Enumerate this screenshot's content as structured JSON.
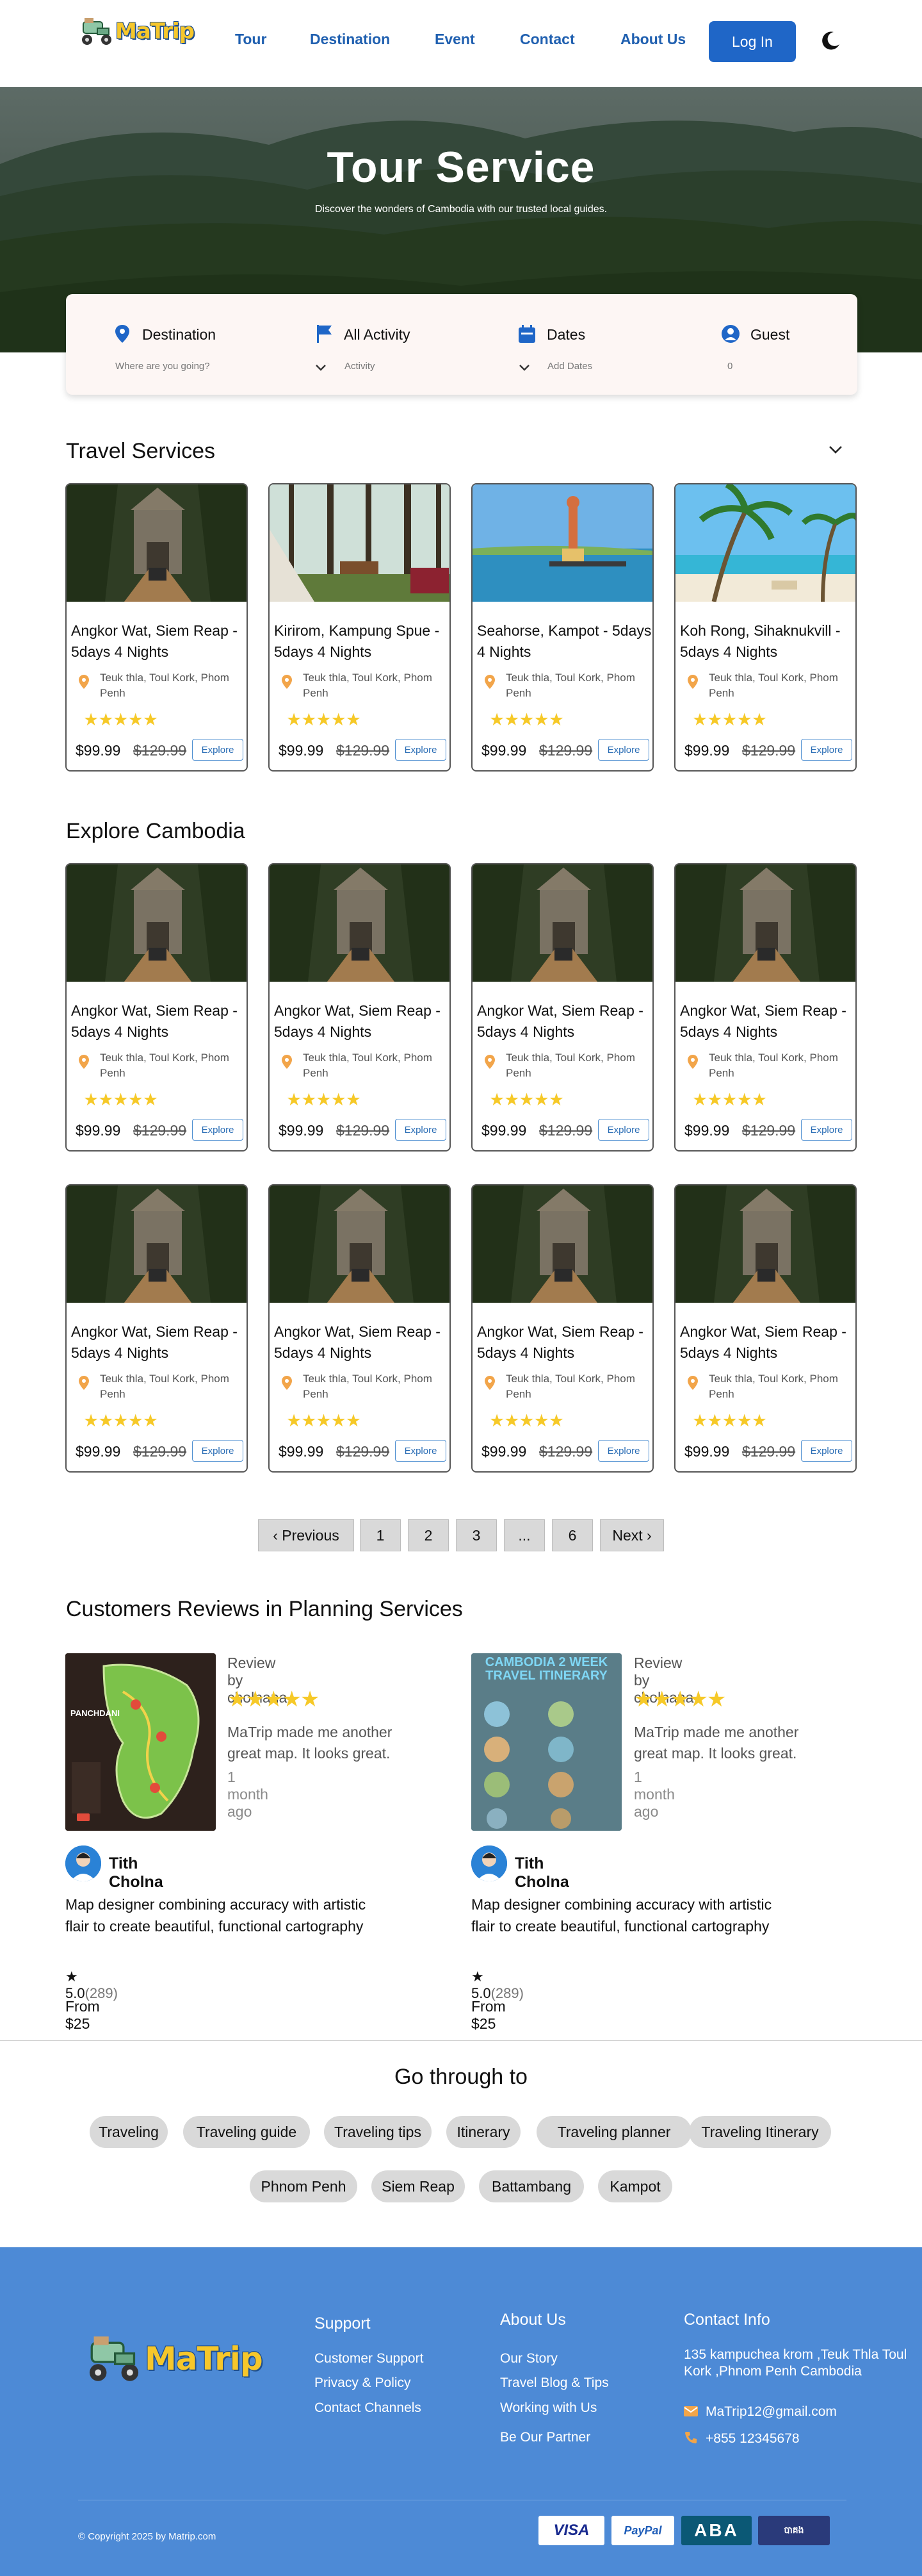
{
  "brand": {
    "logo_text": "MaTrip"
  },
  "nav": {
    "links": [
      "Tour",
      "Destination",
      "Event",
      "Contact",
      "About Us"
    ],
    "login": "Log In"
  },
  "hero": {
    "title": "Tour Service",
    "subtitle": "Discover the wonders of Cambodia with our trusted local guides."
  },
  "search": {
    "destination": {
      "label": "Destination",
      "placeholder": "Where are you going?"
    },
    "activity": {
      "label": "All Activity",
      "placeholder": "Activity"
    },
    "dates": {
      "label": "Dates",
      "placeholder": "Add Dates"
    },
    "guest": {
      "label": "Guest",
      "value": "0"
    }
  },
  "travel_services": {
    "title": "Travel Services",
    "cards": [
      {
        "title": "Angkor Wat, Siem Reap - 5days  4 Nights",
        "location": "Teuk thla, Toul Kork, Phom Penh",
        "stars": "★★★★★",
        "price": "$99.99",
        "old_price": "$129.99",
        "cta": "Explore"
      },
      {
        "title": "Kirirom, Kampung Spue - 5days  4 Nights",
        "location": "Teuk thla, Toul Kork, Phom Penh",
        "stars": "★★★★★",
        "price": "$99.99",
        "old_price": "$129.99",
        "cta": "Explore"
      },
      {
        "title": "Seahorse, Kampot  - 5days  4 Nights",
        "location": "Teuk thla, Toul Kork, Phom Penh",
        "stars": "★★★★★",
        "price": "$99.99",
        "old_price": "$129.99",
        "cta": "Explore"
      },
      {
        "title": "Koh Rong, Sihaknukvill - 5days  4 Nights",
        "location": "Teuk thla, Toul Kork, Phom Penh",
        "stars": "★★★★★",
        "price": "$99.99",
        "old_price": "$129.99",
        "cta": "Explore"
      }
    ]
  },
  "explore": {
    "title": "Explore Cambodia",
    "card": {
      "title": "Angkor Wat, Siem Reap - 5days  4 Nights",
      "location": "Teuk thla, Toul Kork, Phom Penh",
      "stars": "★★★★★",
      "price": "$99.99",
      "old_price": "$129.99",
      "cta": "Explore"
    }
  },
  "pagination": {
    "prev": "‹  Previous",
    "pages": [
      "1",
      "2",
      "3",
      "...",
      "6"
    ],
    "next": "Next  ›"
  },
  "reviews": {
    "title": "Customers Reviews in Planning Services",
    "items": [
      {
        "image_text": "PANCHDANI",
        "by": "Review by cholnana",
        "stars": "★★★★★",
        "text": "MaTrip made me another great map. It looks great.",
        "ago": "1 month ago",
        "name": "Tith Cholna",
        "desc": "Map designer combining accuracy with artistic flair to create beautiful, functional cartography",
        "rating": "5.0",
        "count": "(289)",
        "from": "From $25"
      },
      {
        "image_text": "CAMBODIA 2 WEEK TRAVEL ITINERARY",
        "by": "Review by cholnana",
        "stars": "★★★★★",
        "text": "MaTrip made me another great map. It looks great.",
        "ago": "1 month ago",
        "name": "Tith Cholna",
        "desc": "Map designer combining accuracy with artistic flair to create beautiful, functional cartography",
        "rating": "5.0",
        "count": "(289)",
        "from": "From $25"
      }
    ]
  },
  "go_through": {
    "title": "Go through to",
    "row1": [
      "Traveling",
      "Traveling guide",
      "Traveling tips",
      "Itinerary",
      "Traveling planner",
      "Traveling Itinerary"
    ],
    "row2": [
      "Phnom Penh",
      "Siem Reap",
      "Battambang",
      "Kampot"
    ]
  },
  "footer": {
    "support": {
      "title": "Support",
      "links": [
        "Customer Support",
        "Privacy & Policy",
        "Contact Channels"
      ]
    },
    "about": {
      "title": "About Us",
      "links": [
        "Our Story",
        "Travel Blog & Tips",
        "Working with Us",
        "Be Our Partner"
      ]
    },
    "contact": {
      "title": "Contact Info",
      "address": "135  kampuchea krom ,Teuk Thla Toul Kork ,Phnom Penh Cambodia",
      "email": "MaTrip12@gmail.com",
      "phone": "+855 12345678"
    },
    "copyright": "© Copyright 2025 by Matrip.com",
    "payments": [
      "VISA",
      "PayPal",
      "ABA",
      "បាគង"
    ]
  },
  "colors": {
    "primary": "#1f66c7",
    "footer": "#4d8ad6",
    "star": "#f6c928",
    "pin": "#f2a54a"
  }
}
